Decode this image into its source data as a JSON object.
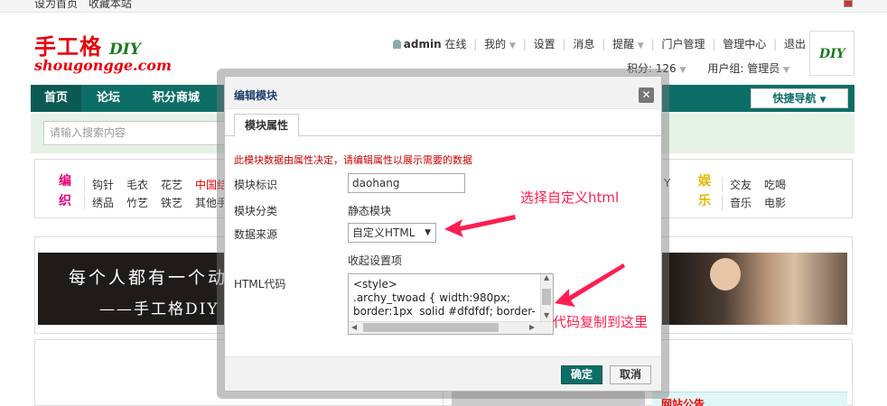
{
  "topbar": {
    "links": [
      "设为首页",
      "收藏本站"
    ]
  },
  "logo": {
    "cn": "手工格",
    "diy": "DIY",
    "en": "shougongge.com"
  },
  "usernav": {
    "username": "admin",
    "online": "在线",
    "items": [
      "我的",
      "设置",
      "消息",
      "提醒",
      "门户管理",
      "管理中心",
      "退出"
    ]
  },
  "userinfo": {
    "points": "积分: 126",
    "group": "用户组: 管理员"
  },
  "avatar": {
    "label": "DIY"
  },
  "mainnav": {
    "items": [
      "首页",
      "论坛",
      "积分商城"
    ],
    "quicknav": "快捷导航"
  },
  "search": {
    "placeholder": "请输入搜索内容"
  },
  "categories": {
    "left_label_1": "编",
    "left_label_2": "织",
    "row1": [
      "钩针",
      "毛衣",
      "花艺",
      "中国结"
    ],
    "row2": [
      "绣品",
      "竹艺",
      "铁艺",
      "其他手"
    ],
    "right_label_1": "娱",
    "right_label_2": "乐",
    "right_row1": [
      "交友",
      "吃喝"
    ],
    "right_row2": [
      "音乐",
      "电影"
    ],
    "right_partial": "Y"
  },
  "banner": {
    "line1": "每个人都有一个动",
    "line2": "——手工格DIY"
  },
  "lower": {
    "notice": "网站公告"
  },
  "dialog": {
    "title": "编辑模块",
    "close": "✕",
    "tab": "模块属性",
    "note": "此模块数据由属性决定，请编辑属性以展示需要的数据",
    "id_label": "模块标识",
    "id_value": "daohang",
    "category_label": "模块分类",
    "category_value": "静态模块",
    "source_label": "数据来源",
    "source_value": "自定义HTML",
    "collapse_link": "收起设置项",
    "code_label": "HTML代码",
    "code_value": "<style>\n.archy_twoad { width:980px;\nborder:1px  solid #dfdfdf; border-",
    "ok": "确定",
    "cancel": "取消"
  },
  "annotations": {
    "select_html": "选择自定义html",
    "paste_code": "代码复制到这里"
  },
  "colors": {
    "nav": "#0d6e67",
    "brand_red": "#e8000b",
    "annotation": "#ff1e50"
  }
}
